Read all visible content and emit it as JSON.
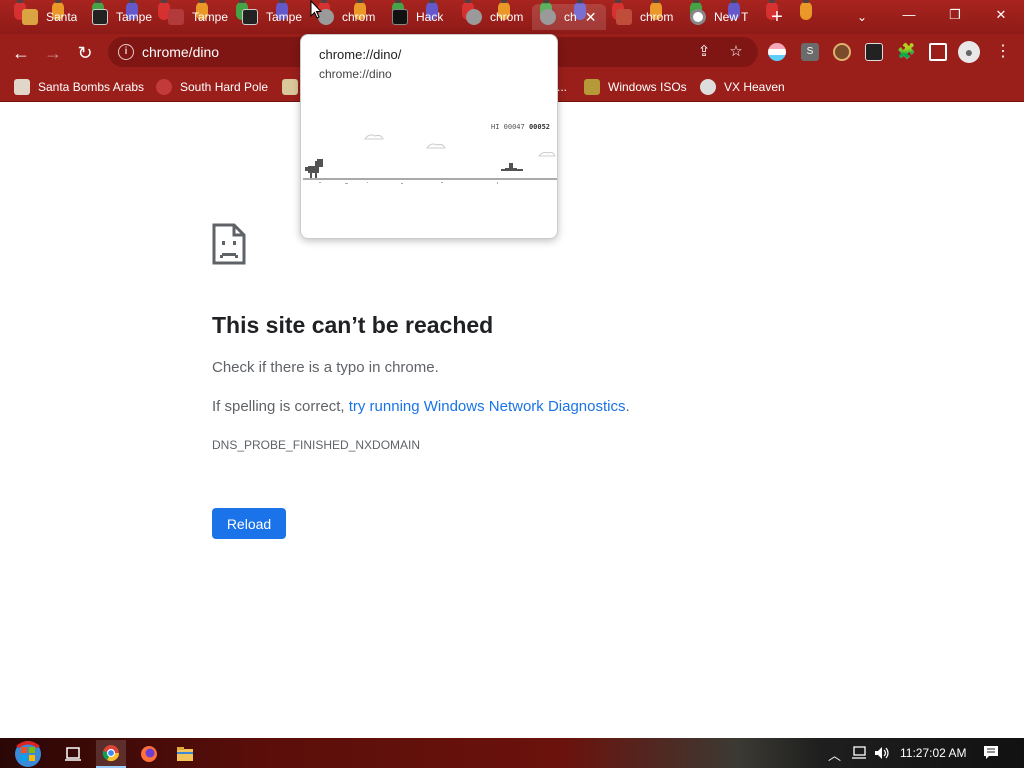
{
  "browser": {
    "tabs": [
      {
        "title": "Santa",
        "favicon": "santa-icon",
        "color": "#d9a441"
      },
      {
        "title": "Tampe",
        "favicon": "tampermonkey-icon",
        "color": "#222222"
      },
      {
        "title": "Tampe",
        "favicon": "greasyfork-icon",
        "color": "#b23a3a"
      },
      {
        "title": "Tampe",
        "favicon": "tampermonkey-icon",
        "color": "#222222"
      },
      {
        "title": "chrom",
        "favicon": "globe-icon",
        "color": "#9a9a9a"
      },
      {
        "title": "Hack",
        "favicon": "hack-icon",
        "color": "#111111"
      },
      {
        "title": "chrom",
        "favicon": "globe-icon",
        "color": "#9a9a9a"
      },
      {
        "title": "ch",
        "favicon": "globe-icon",
        "color": "#9a9a9a",
        "active": true,
        "close": "✕"
      },
      {
        "title": "chrom",
        "favicon": "s-icon",
        "color": "#c04c3a"
      },
      {
        "title": "New T",
        "favicon": "chrome-icon",
        "color": "#ffffff"
      }
    ],
    "new_tab_label": "+",
    "tab_search": "⌄",
    "window_controls": {
      "minimize": "—",
      "restore": "❐",
      "close": "✕"
    },
    "toolbar": {
      "back": "←",
      "forward": "→",
      "reload": "↻",
      "url": "chrome/dino",
      "info": "i",
      "share": "⇪",
      "star": "☆",
      "extensions": [
        "flag-icon",
        "s-extension-icon",
        "avatar-extension-icon",
        "tampermonkey-extension-icon",
        "puzzle-icon",
        "sidepanel-icon",
        "profile-icon",
        "menu-icon"
      ],
      "ext_s": "S",
      "menu": "⋮"
    },
    "bookmarks": [
      {
        "label": "Santa Bombs Arabs",
        "icon": "santa-icon",
        "color": "#e0d7c8"
      },
      {
        "label": "South Hard Pole",
        "icon": "snowflake-icon",
        "color": "#c33a3a"
      },
      {
        "label": "",
        "icon": "image-icon",
        "color": "#d8c89a"
      },
      {
        "label": "Windows ISOs",
        "icon": "figure-icon",
        "color": "#b69a3a"
      },
      {
        "label": "VX Heaven",
        "icon": "skull-icon",
        "color": "#dddddd"
      }
    ],
    "bookmark_overflow": "..."
  },
  "error_page": {
    "title": "This site can’t be reached",
    "line1": "Check if there is a typo in chrome.",
    "line2_prefix": "If spelling is correct, ",
    "line2_link": "try running Windows Network Diagnostics",
    "line2_suffix": ".",
    "code": "DNS_PROBE_FINISHED_NXDOMAIN",
    "reload_label": "Reload"
  },
  "hover_card": {
    "title": "chrome://dino/",
    "subtitle": "chrome://dino",
    "hi_label": "HI",
    "hi_score": "00047",
    "score": "00052"
  },
  "taskbar": {
    "apps": [
      "start-icon",
      "task-view-icon",
      "chrome-icon",
      "firefox-icon",
      "file-explorer-icon"
    ],
    "tray_chevron": "︿",
    "clock": "11:27:02 AM"
  }
}
